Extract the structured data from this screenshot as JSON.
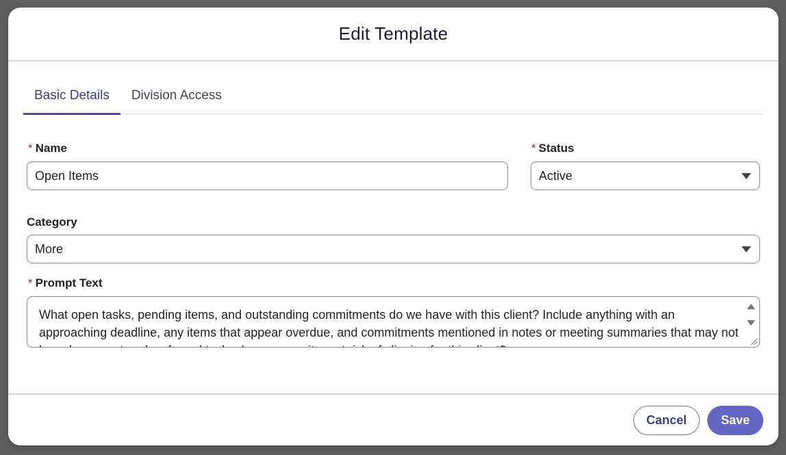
{
  "modal": {
    "title": "Edit Template"
  },
  "tabs": [
    {
      "label": "Basic Details",
      "active": true
    },
    {
      "label": "Division Access",
      "active": false
    }
  ],
  "form": {
    "required_marker": "*",
    "name": {
      "label": "Name",
      "value": "Open Items"
    },
    "status": {
      "label": "Status",
      "value": "Active"
    },
    "category": {
      "label": "Category",
      "value": "More"
    },
    "prompt_text": {
      "label": "Prompt Text",
      "value": "What open tasks, pending items, and outstanding commitments do we have with this client? Include anything with an approaching deadline, any items that appear overdue, and commitments mentioned in notes or meeting summaries that may not have been captured as formal tasks. Is any open item at risk of slipping for this client?"
    }
  },
  "footer": {
    "cancel_label": "Cancel",
    "save_label": "Save"
  },
  "colors": {
    "accent": "#4a4d9c",
    "save_button": "#6466c4",
    "required": "#b0213a"
  }
}
